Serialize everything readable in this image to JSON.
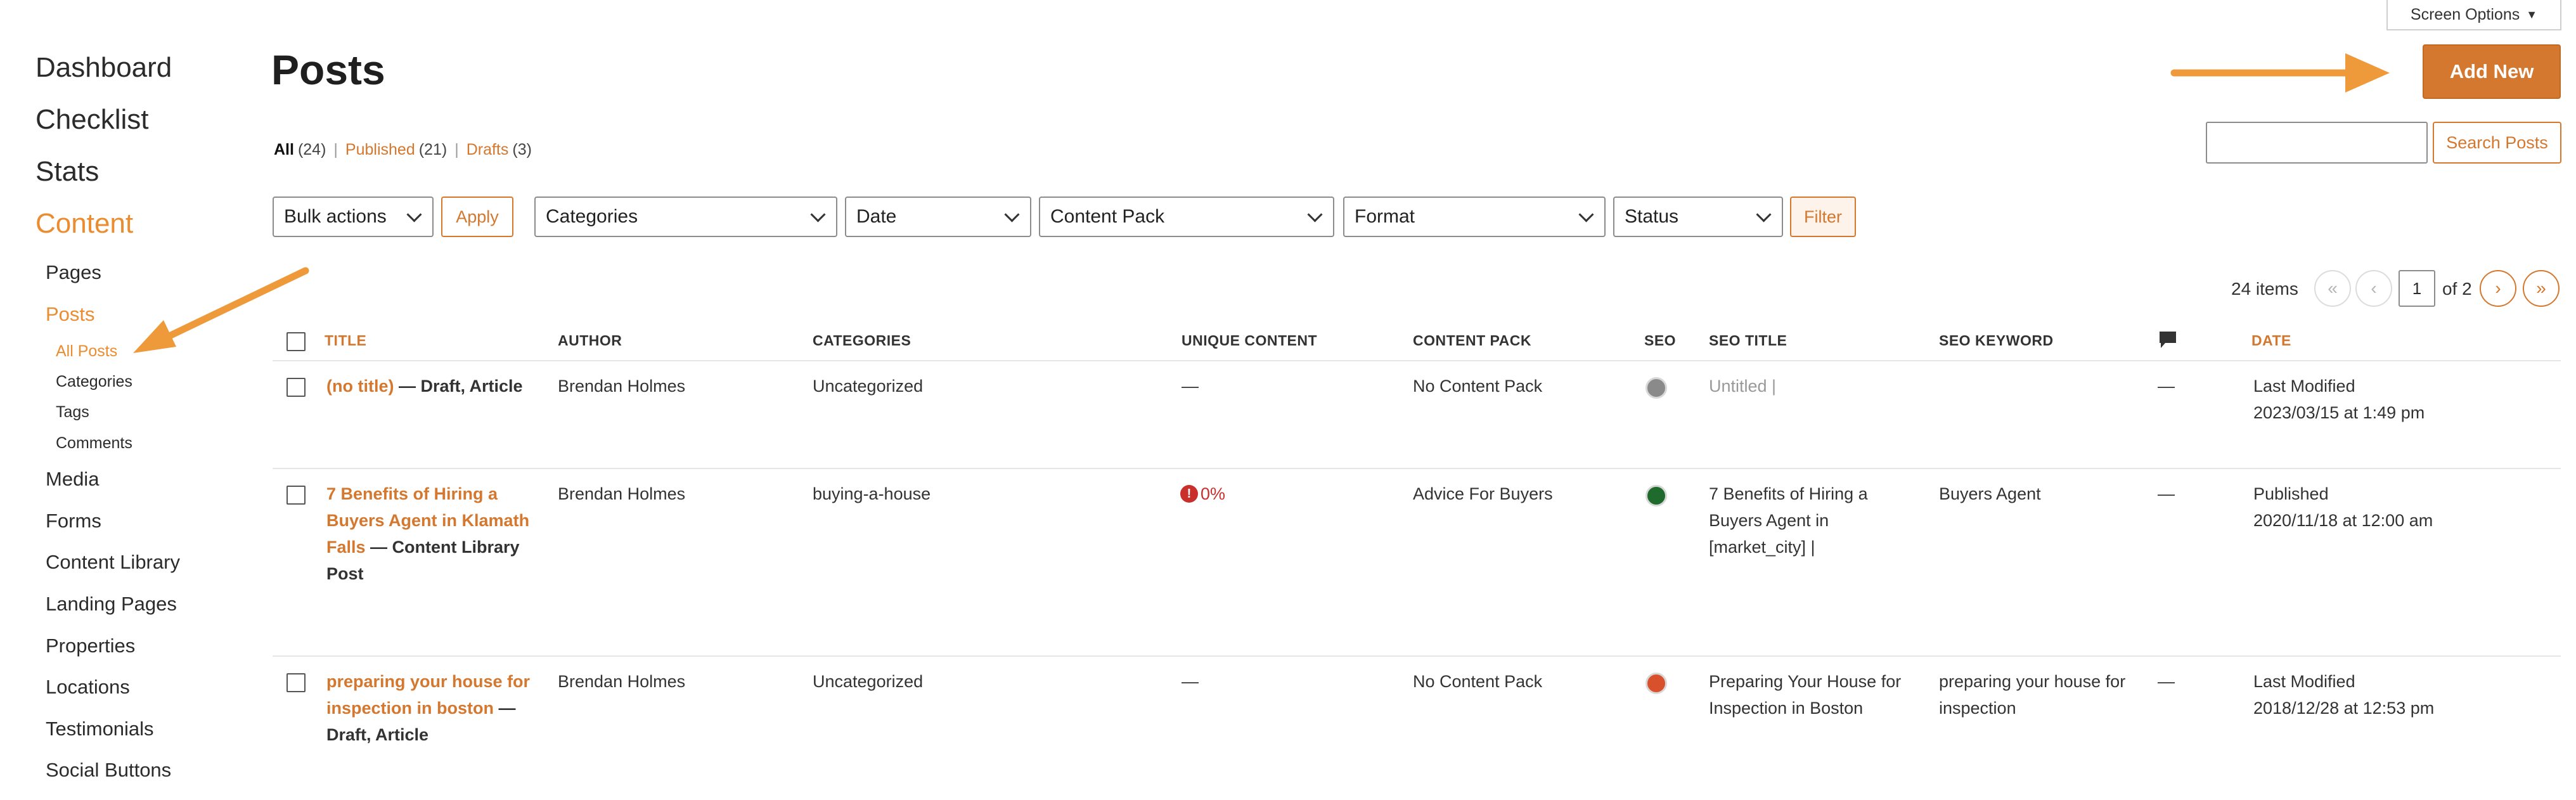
{
  "sidebar": {
    "top": [
      {
        "label": "Dashboard"
      },
      {
        "label": "Checklist"
      },
      {
        "label": "Stats"
      },
      {
        "label": "Content"
      }
    ],
    "items": [
      {
        "label": "Pages"
      },
      {
        "label": "Posts"
      },
      {
        "label": "All Posts"
      },
      {
        "label": "Categories"
      },
      {
        "label": "Tags"
      },
      {
        "label": "Comments"
      },
      {
        "label": "Media"
      },
      {
        "label": "Forms"
      },
      {
        "label": "Content Library"
      },
      {
        "label": "Landing Pages"
      },
      {
        "label": "Properties"
      },
      {
        "label": "Locations"
      },
      {
        "label": "Testimonials"
      },
      {
        "label": "Social Buttons"
      }
    ]
  },
  "header": {
    "title": "Posts",
    "screen_options": "Screen Options",
    "add_new": "Add New",
    "search_button": "Search Posts",
    "search_value": ""
  },
  "status_filter": {
    "all": {
      "label": "All",
      "count": "(24)"
    },
    "published": {
      "label": "Published",
      "count": "(21)"
    },
    "drafts": {
      "label": "Drafts",
      "count": "(3)"
    },
    "sep": "|"
  },
  "filters": {
    "bulk_actions": "Bulk actions",
    "apply": "Apply",
    "categories": "Categories",
    "date": "Date",
    "content_pack": "Content Pack",
    "format": "Format",
    "status": "Status",
    "filter": "Filter"
  },
  "pagination": {
    "items": "24 items",
    "first": "«",
    "prev": "‹",
    "current": "1",
    "of": "of 2",
    "next": "›",
    "last": "»"
  },
  "table": {
    "columns": {
      "title": "TITLE",
      "author": "AUTHOR",
      "categories": "CATEGORIES",
      "unique_content": "UNIQUE CONTENT",
      "content_pack": "CONTENT PACK",
      "seo": "SEO",
      "seo_title": "SEO TITLE",
      "seo_keyword": "SEO KEYWORD",
      "date": "DATE"
    },
    "rows": [
      {
        "title": "(no title)",
        "state": " — Draft, Article",
        "author": "Brendan Holmes",
        "category": "Uncategorized",
        "unique_content": "—",
        "content_pack": "No Content Pack",
        "seo_color": "#8a8a8a",
        "seo_title": "Untitled |",
        "seo_keyword": "",
        "comments": "—",
        "date_status": "Last Modified",
        "date": "2023/03/15 at 1:49 pm"
      },
      {
        "title": "7 Benefits of Hiring a Buyers Agent in Klamath Falls",
        "state": " — Content Library Post",
        "author": "Brendan Holmes",
        "category": "buying-a-house",
        "unique_content": "0%",
        "content_pack": "Advice For Buyers",
        "seo_color": "#1f6b2e",
        "seo_title": "7 Benefits of Hiring a Buyers Agent in [market_city] |",
        "seo_keyword": "Buyers Agent",
        "comments": "—",
        "date_status": "Published",
        "date": "2020/11/18 at 12:00 am"
      },
      {
        "title": "preparing your house for inspection in boston",
        "state": " — Draft, Article",
        "author": "Brendan Holmes",
        "category": "Uncategorized",
        "unique_content": "—",
        "content_pack": "No Content Pack",
        "seo_color": "#d9512c",
        "seo_title": "Preparing Your House for Inspection in Boston",
        "seo_keyword": "preparing your house for inspection",
        "comments": "—",
        "date_status": "Last Modified",
        "date": "2018/12/28 at 12:53 pm"
      }
    ]
  },
  "colors": {
    "accent": "#d4782f",
    "annotation_arrow": "#ef9a3a"
  }
}
